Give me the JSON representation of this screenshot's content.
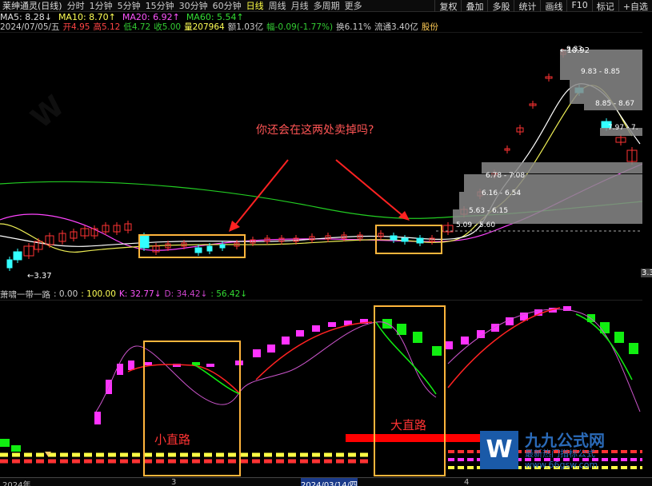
{
  "toolbar": {
    "title": "莱绅通灵(日线)",
    "periods": [
      "分时",
      "1分钟",
      "5分钟",
      "15分钟",
      "30分钟",
      "60分钟",
      "日线",
      "周线",
      "月线",
      "多周期",
      "更多"
    ],
    "active": "日线",
    "right": [
      "复权",
      "叠加",
      "多股",
      "统计",
      "画线",
      "F10",
      "标记",
      "+自选"
    ]
  },
  "ma": [
    {
      "t": "MA5: 8.28",
      "a": "↓",
      "c": "#e0e0e0"
    },
    {
      "t": "MA10: 8.70",
      "a": "↑",
      "c": "#ffff55"
    },
    {
      "t": "MA20: 6.92",
      "a": "↑",
      "c": "#ff55ff"
    },
    {
      "t": "MA60: 5.54",
      "a": "↑",
      "c": "#33dd33"
    }
  ],
  "info": [
    {
      "t": "2024/07/05/五",
      "c": "#ccc"
    },
    {
      "t": "开4.95",
      "c": "#ff4444"
    },
    {
      "t": "高5.12",
      "c": "#ff4444"
    },
    {
      "t": "低4.72",
      "c": "#33cc33"
    },
    {
      "t": "收5.00",
      "c": "#33cc33"
    },
    {
      "t": "量207964",
      "c": "#ffff55"
    },
    {
      "t": "额1.03亿",
      "c": "#ccc"
    },
    {
      "t": "幅-0.09(-1.77%)",
      "c": "#33cc33"
    },
    {
      "t": "换6.11%",
      "c": "#ccc"
    },
    {
      "t": "流通3.40亿",
      "c": "#ccc"
    },
    {
      "t": "股份",
      "c": "#ffcc55"
    }
  ],
  "indicator": [
    {
      "t": "萧啸一带一路",
      "c": "#ccc"
    },
    {
      "t": ": 0.00",
      "c": "#ccc"
    },
    {
      "t": ": 100.00",
      "c": "#ffff55"
    },
    {
      "t": "K: 32.77",
      "c": "#ff55ff",
      "a": "↓"
    },
    {
      "t": "D: 34.42",
      "c": "#cc44cc",
      "a": "↓"
    },
    {
      "t": ": 56.42",
      "c": "#33dd33",
      "a": "↓"
    }
  ],
  "annotations": {
    "question": "你还会在这两处卖掉吗?",
    "small": "小直路",
    "big": "大直路"
  },
  "price_labels": {
    "low": "←3.37",
    "high": "←10.92",
    "right_val": "3.3"
  },
  "chip_labels": [
    "9.83",
    "9.83 - 8.85",
    "8.85 - 8.67",
    "7.97 - 7.",
    "6.78 - 7.08",
    "6.16 - 6.54",
    "5.63 - 6.15",
    "5.09 - 5.60"
  ],
  "axis": {
    "labels": [
      "2024年",
      "3",
      "2024/03/14/四",
      "4"
    ]
  },
  "watermark": {
    "site": "www.66gsw.com",
    "brand": "九九公式网",
    "tag": "最新热门指标公式"
  },
  "colors": {
    "up": "#ff3333",
    "down": "#33ffff",
    "box": "#ffb53c",
    "arrow": "#ff2222",
    "magenta": "#ff33ff",
    "green": "#11ee11"
  }
}
